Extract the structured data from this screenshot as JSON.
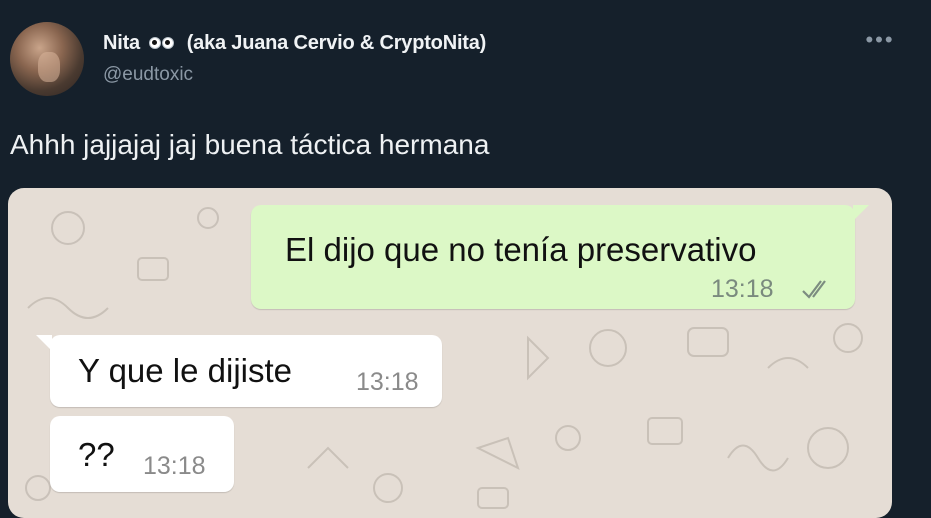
{
  "tweet": {
    "display_name": "Nita",
    "display_name_suffix": "(aka Juana Cervio & CryptoNita)",
    "handle": "@eudtoxic",
    "more_icon": "more-horizontal-icon",
    "text": "Ahhh jajjajaj jaj buena táctica hermana"
  },
  "chat": {
    "messages": [
      {
        "direction": "outgoing",
        "text": "El dijo que no tenía preservativo",
        "time": "13:18",
        "status": "read-double-check"
      },
      {
        "direction": "incoming",
        "text": "Y que le dijiste",
        "time": "13:18"
      },
      {
        "direction": "incoming",
        "text": "??",
        "time": "13:18"
      }
    ]
  },
  "colors": {
    "background": "#15202b",
    "outgoing_bubble": "#dcf8c6",
    "incoming_bubble": "#ffffff",
    "chat_wallpaper": "#e5ddd5"
  }
}
